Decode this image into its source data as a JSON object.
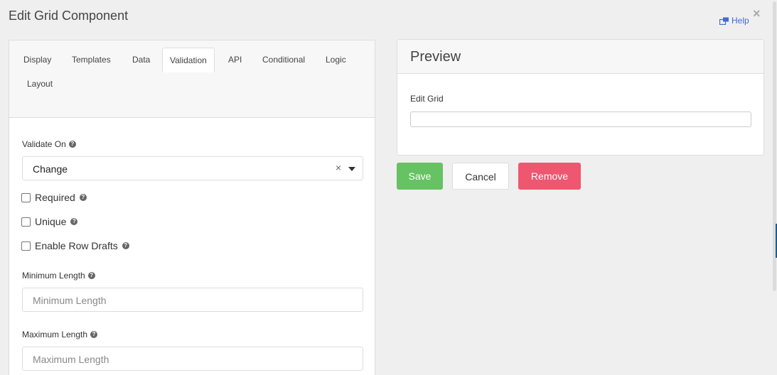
{
  "modal": {
    "title": "Edit Grid Component",
    "help_label": "Help",
    "close_label": "×"
  },
  "tabs": [
    "Display",
    "Templates",
    "Data",
    "Validation",
    "API",
    "Conditional",
    "Logic",
    "Layout"
  ],
  "active_tab": "Validation",
  "validate_on": {
    "label": "Validate On",
    "value": "Change",
    "clear": "×"
  },
  "checkboxes": [
    {
      "label": "Required",
      "checked": false
    },
    {
      "label": "Unique",
      "checked": false
    },
    {
      "label": "Enable Row Drafts",
      "checked": false
    }
  ],
  "min_length": {
    "label": "Minimum Length",
    "placeholder": "Minimum Length"
  },
  "max_length": {
    "label": "Maximum Length",
    "placeholder": "Maximum Length"
  },
  "preview": {
    "title": "Preview",
    "field_label": "Edit Grid"
  },
  "buttons": {
    "save": "Save",
    "cancel": "Cancel",
    "remove": "Remove"
  },
  "colors": {
    "save": "#66c262",
    "remove": "#ef5670",
    "link": "#3f6ad8"
  }
}
